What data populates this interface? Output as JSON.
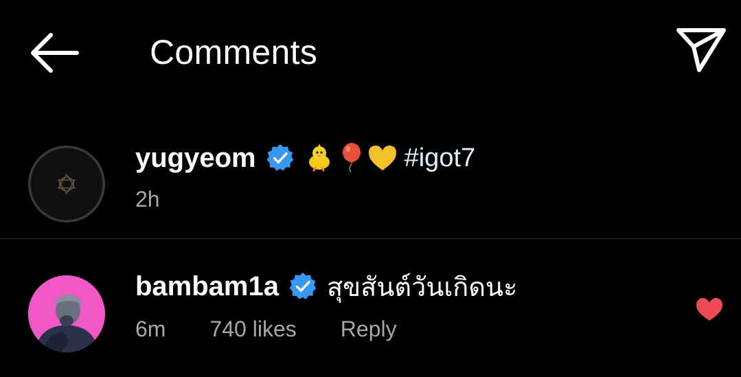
{
  "header": {
    "title": "Comments",
    "back_icon": "arrow-left-icon",
    "share_icon": "paper-plane-icon"
  },
  "comments": [
    {
      "username": "yugyeom",
      "verified": true,
      "emojis": [
        "chick-emoji",
        "balloon-emoji",
        "yellow-heart-emoji"
      ],
      "hashtag": "#igot7",
      "time": "2h"
    },
    {
      "username": "bambam1a",
      "verified": true,
      "text": "สุขสันต์วันเกิดนะ",
      "time": "6m",
      "likes": "740 likes",
      "reply": "Reply",
      "liked": true
    }
  ],
  "colors": {
    "background": "#000000",
    "verified_blue": "#3897f0",
    "like_red": "#ed4956",
    "meta_gray": "#a8a8a8",
    "hashtag": "#e0f1ff"
  }
}
